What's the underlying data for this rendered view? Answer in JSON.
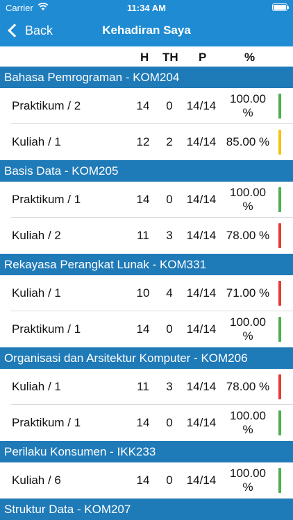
{
  "status_bar": {
    "carrier": "Carrier",
    "time": "11:34 AM"
  },
  "nav": {
    "back_label": "Back",
    "title": "Kehadiran Saya"
  },
  "columns": {
    "h": "H",
    "th": "TH",
    "p": "P",
    "pct": "%"
  },
  "colors": {
    "nav_bg": "#1f8bd3",
    "section_bg": "#1f7ab8",
    "green": "#4caf50",
    "yellow": "#f5c211",
    "red": "#e53935"
  },
  "sections": [
    {
      "title": "Bahasa Pemrograman - KOM204",
      "rows": [
        {
          "name": "Praktikum / 2",
          "h": "14",
          "th": "0",
          "p": "14/14",
          "pct": "100.00 %",
          "status": "green"
        },
        {
          "name": "Kuliah / 1",
          "h": "12",
          "th": "2",
          "p": "14/14",
          "pct": "85.00 %",
          "status": "yellow"
        }
      ]
    },
    {
      "title": "Basis Data - KOM205",
      "rows": [
        {
          "name": "Praktikum / 1",
          "h": "14",
          "th": "0",
          "p": "14/14",
          "pct": "100.00 %",
          "status": "green"
        },
        {
          "name": "Kuliah / 2",
          "h": "11",
          "th": "3",
          "p": "14/14",
          "pct": "78.00 %",
          "status": "red"
        }
      ]
    },
    {
      "title": "Rekayasa Perangkat Lunak - KOM331",
      "rows": [
        {
          "name": "Kuliah / 1",
          "h": "10",
          "th": "4",
          "p": "14/14",
          "pct": "71.00 %",
          "status": "red"
        },
        {
          "name": "Praktikum / 1",
          "h": "14",
          "th": "0",
          "p": "14/14",
          "pct": "100.00 %",
          "status": "green"
        }
      ]
    },
    {
      "title": "Organisasi dan Arsitektur Komputer - KOM206",
      "rows": [
        {
          "name": "Kuliah / 1",
          "h": "11",
          "th": "3",
          "p": "14/14",
          "pct": "78.00 %",
          "status": "red"
        },
        {
          "name": "Praktikum / 1",
          "h": "14",
          "th": "0",
          "p": "14/14",
          "pct": "100.00 %",
          "status": "green"
        }
      ]
    },
    {
      "title": "Perilaku Konsumen - IKK233",
      "rows": [
        {
          "name": "Kuliah / 6",
          "h": "14",
          "th": "0",
          "p": "14/14",
          "pct": "100.00 %",
          "status": "green"
        }
      ]
    },
    {
      "title": "Struktur Data - KOM207",
      "rows": []
    }
  ]
}
